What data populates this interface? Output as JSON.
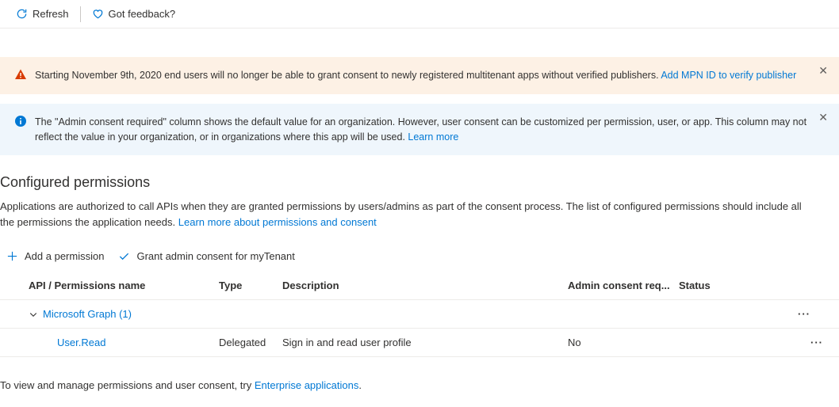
{
  "toolbar": {
    "refresh_label": "Refresh",
    "feedback_label": "Got feedback?"
  },
  "banners": {
    "warning": {
      "text": "Starting November 9th, 2020 end users will no longer be able to grant consent to newly registered multitenant apps without verified publishers. ",
      "link_label": "Add MPN ID to verify publisher"
    },
    "info": {
      "text": "The \"Admin consent required\" column shows the default value for an organization. However, user consent can be customized per permission, user, or app. This column may not reflect the value in your organization, or in organizations where this app will be used. ",
      "link_label": "Learn more"
    }
  },
  "section": {
    "title": "Configured permissions",
    "description_prefix": "Applications are authorized to call APIs when they are granted permissions by users/admins as part of the consent process. The list of configured permissions should include all the permissions the application needs. ",
    "description_link": "Learn more about permissions and consent"
  },
  "actions": {
    "add_label": "Add a permission",
    "grant_label": "Grant admin consent for myTenant"
  },
  "table": {
    "headers": {
      "name": "API / Permissions name",
      "type": "Type",
      "description": "Description",
      "admin_consent": "Admin consent req...",
      "status": "Status"
    },
    "group": {
      "name": "Microsoft Graph (1)"
    },
    "rows": [
      {
        "name": "User.Read",
        "type": "Delegated",
        "description": "Sign in and read user profile",
        "admin_consent": "No",
        "status": ""
      }
    ]
  },
  "footer": {
    "prefix": "To view and manage permissions and user consent, try ",
    "link": "Enterprise applications",
    "suffix": "."
  }
}
